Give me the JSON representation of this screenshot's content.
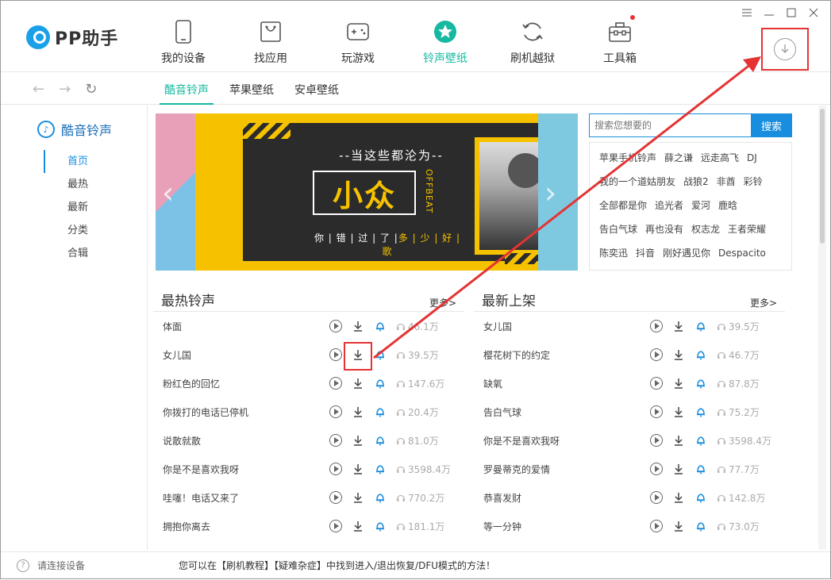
{
  "app": {
    "logo_text": "PP助手"
  },
  "nav": [
    {
      "label": "我的设备",
      "icon": "phone-icon"
    },
    {
      "label": "找应用",
      "icon": "bag-icon"
    },
    {
      "label": "玩游戏",
      "icon": "gamepad-icon"
    },
    {
      "label": "铃声壁纸",
      "icon": "star-icon",
      "active": true
    },
    {
      "label": "刷机越狱",
      "icon": "refresh-icon"
    },
    {
      "label": "工具箱",
      "icon": "toolbox-icon"
    }
  ],
  "subtabs": [
    "酷音铃声",
    "苹果壁纸",
    "安卓壁纸"
  ],
  "sidebar": {
    "title": "酷音铃声",
    "items": [
      "首页",
      "最热",
      "最新",
      "分类",
      "合辑"
    ]
  },
  "banner": {
    "line1": "--当这些都沦为--",
    "big": "小众",
    "offbeat": "OFFBEAT",
    "line3_a": "你 | 错 | 过 | 了 |",
    "line3_b": "多 | 少 | 好 | 歌"
  },
  "search": {
    "placeholder": "搜索您想要的",
    "button": "搜索"
  },
  "hot_words": [
    [
      "苹果手机铃声",
      "薛之谦",
      "远走高飞",
      "DJ"
    ],
    [
      "我的一个道姑朋友",
      "战狼2",
      "非酋",
      "彩铃"
    ],
    [
      "全部都是你",
      "追光者",
      "爱河",
      "鹿晗"
    ],
    [
      "告白气球",
      "再也没有",
      "权志龙",
      "王者荣耀"
    ],
    [
      "陈奕迅",
      "抖音",
      "刚好遇见你",
      "Despacito"
    ]
  ],
  "hot_section": {
    "title": "最热铃声",
    "more": "更多>",
    "rows": [
      {
        "name": "体面",
        "count": "46.1万"
      },
      {
        "name": "女儿国",
        "count": "39.5万"
      },
      {
        "name": "粉红色的回忆",
        "count": "147.6万"
      },
      {
        "name": "你拨打的电话已停机",
        "count": "20.4万"
      },
      {
        "name": "说散就散",
        "count": "81.0万"
      },
      {
        "name": "你是不是喜欢我呀",
        "count": "3598.4万"
      },
      {
        "name": "哇噻！电话又来了",
        "count": "770.2万"
      },
      {
        "name": "拥抱你离去",
        "count": "181.1万"
      }
    ]
  },
  "new_section": {
    "title": "最新上架",
    "more": "更多>",
    "rows": [
      {
        "name": "女儿国",
        "count": "39.5万"
      },
      {
        "name": "樱花树下的约定",
        "count": "46.7万"
      },
      {
        "name": "缺氧",
        "count": "87.8万"
      },
      {
        "name": "告白气球",
        "count": "75.2万"
      },
      {
        "name": "你是不是喜欢我呀",
        "count": "3598.4万"
      },
      {
        "name": "罗曼蒂克的爱情",
        "count": "77.7万"
      },
      {
        "name": "恭喜发财",
        "count": "142.8万"
      },
      {
        "name": "等一分钟",
        "count": "73.0万"
      }
    ]
  },
  "status": {
    "connect": "请连接设备",
    "tip": "您可以在【刷机教程】【疑难杂症】中找到进入/退出恢复/DFU模式的方法！"
  },
  "colors": {
    "accent": "#16b8a0",
    "blue": "#1a8ede",
    "highlight": "#e53333"
  }
}
